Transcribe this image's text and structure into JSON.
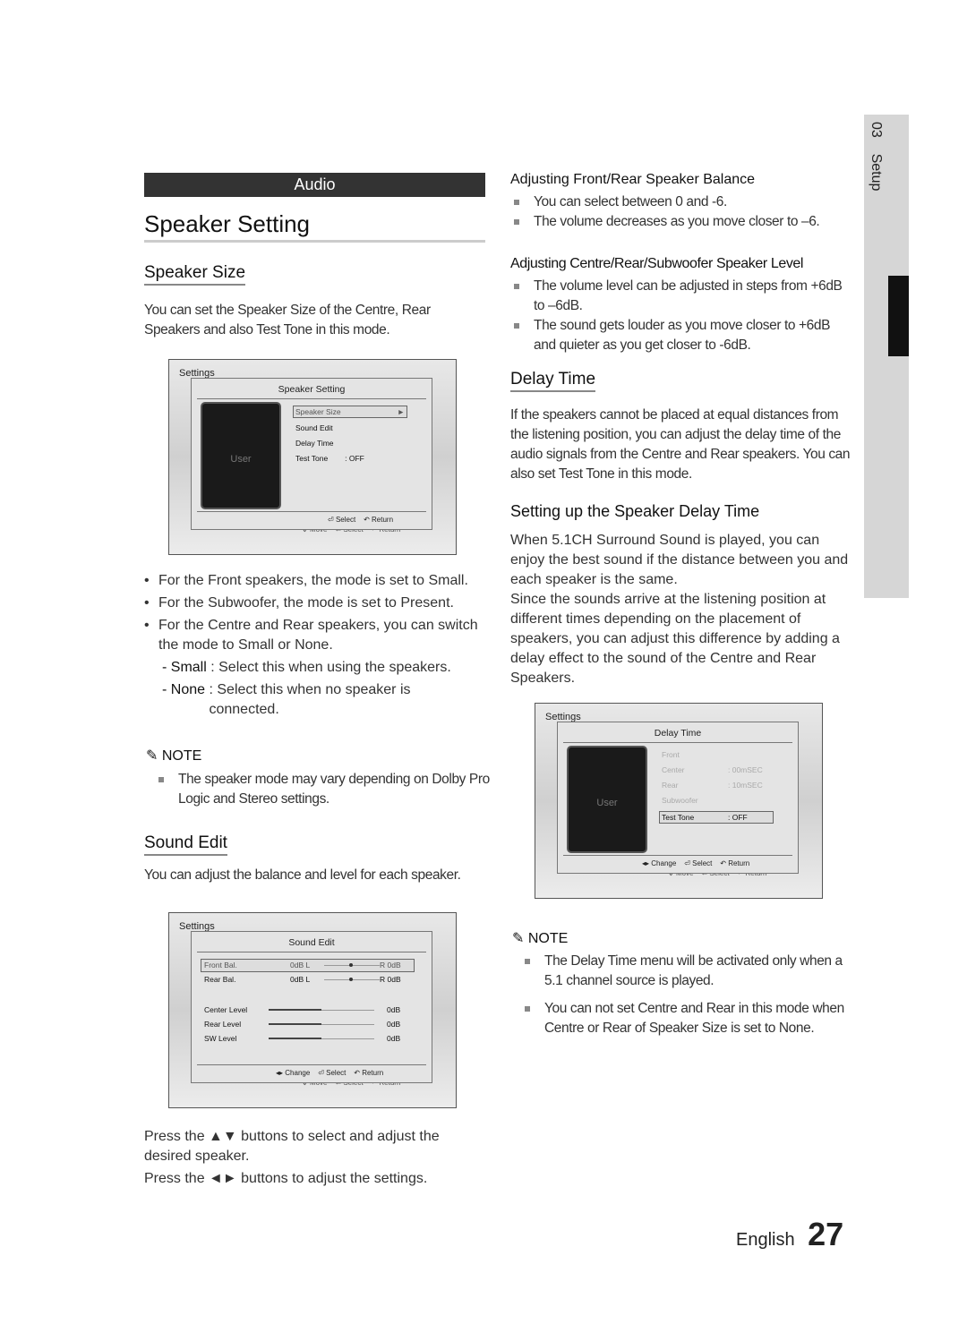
{
  "section_header": "Audio",
  "title": "Speaker Setting",
  "speaker_size": {
    "heading": "Speaker Size",
    "intro": "You can set the Speaker Size of the Centre, Rear Speakers and also Test Tone in this mode.",
    "screen": {
      "settings": "Settings",
      "title": "Speaker Setting",
      "tv_label": "User",
      "items": [
        "Speaker Size",
        "Sound Edit",
        "Delay Time",
        "Test Tone"
      ],
      "test_tone_value": ": OFF",
      "footer": [
        "Select",
        "Return"
      ],
      "ghost": [
        "Move",
        "Select",
        "Return"
      ]
    },
    "bullets": [
      "For the Front speakers, the mode is set to Small.",
      "For the Subwoofer, the mode is set to Present.",
      "For the Centre and Rear speakers, you can switch the mode to Small or None."
    ],
    "options": [
      {
        "key": "- Small",
        "text": ": Select this when using the speakers."
      },
      {
        "key": "- None",
        "text": ": Select this when no speaker is connected."
      }
    ],
    "note_label": "NOTE",
    "note": "The speaker mode may vary depending on Dolby Pro Logic and Stereo settings."
  },
  "sound_edit": {
    "heading": "Sound Edit",
    "intro": "You can adjust the balance and level for each speaker.",
    "screen": {
      "settings": "Settings",
      "title": "Sound Edit",
      "balance": [
        {
          "label": "Front Bal.",
          "left": "0dB L",
          "right": "R 0dB"
        },
        {
          "label": "Rear Bal.",
          "left": "0dB L",
          "right": "R 0dB"
        }
      ],
      "levels": [
        {
          "label": "Center Level",
          "value": "0dB",
          "level": 0.5
        },
        {
          "label": "Rear Level",
          "value": "0dB",
          "level": 0.5
        },
        {
          "label": "SW Level",
          "value": "0dB",
          "level": 0.5
        }
      ],
      "footer": [
        "Change",
        "Select",
        "Return"
      ],
      "ghost": [
        "Move",
        "Select",
        "Return"
      ]
    },
    "press1": "Press the ▲▼ buttons to select and adjust the desired speaker.",
    "press2": "Press the ◄► buttons to adjust the settings."
  },
  "balance": {
    "heading": "Adjusting Front/Rear Speaker Balance",
    "items": [
      "You can select between 0 and -6.",
      "The volume decreases as you move closer to –6."
    ]
  },
  "level": {
    "heading": "Adjusting Centre/Rear/Subwoofer Speaker Level",
    "items": [
      "The volume level can be adjusted in steps from +6dB to –6dB.",
      "The sound gets louder as you move closer to +6dB and quieter as you get closer to -6dB."
    ]
  },
  "delay_time": {
    "heading": "Delay Time",
    "intro": "If the speakers cannot be placed at equal distances from the listening position, you can adjust the delay time of the audio signals from the Centre and  Rear speakers. You can also set Test Tone in this mode.",
    "sub": "Setting up the Speaker Delay Time",
    "p1": "When 5.1CH Surround Sound is played, you can enjoy the best sound if the distance between you and each speaker is the same.",
    "p2": "Since the sounds arrive at the listening position at different times depending on the placement of speakers, you can adjust this difference by adding a delay effect to the sound of the Centre and Rear Speakers.",
    "screen": {
      "settings": "Settings",
      "title": "Delay Time",
      "tv_label": "User",
      "items": [
        {
          "label": "Front",
          "value": ""
        },
        {
          "label": "Center",
          "value": ":  00mSEC"
        },
        {
          "label": "Rear",
          "value": ":  10mSEC"
        },
        {
          "label": "Subwoofer",
          "value": ""
        },
        {
          "label": "Test Tone",
          "value": ":  OFF"
        }
      ],
      "footer": [
        "Change",
        "Select",
        "Return"
      ],
      "ghost": [
        "Move",
        "Select",
        "Return"
      ]
    },
    "note_label": "NOTE",
    "notes": [
      "The Delay Time menu will be activated only when a 5.1 channel source is played.",
      "You can not set Centre and Rear in this mode when Centre or Rear of Speaker Size is set to None."
    ]
  },
  "side_tab": {
    "chapter": "03",
    "label": "Setup"
  },
  "footer": {
    "language": "English",
    "page": "27"
  }
}
